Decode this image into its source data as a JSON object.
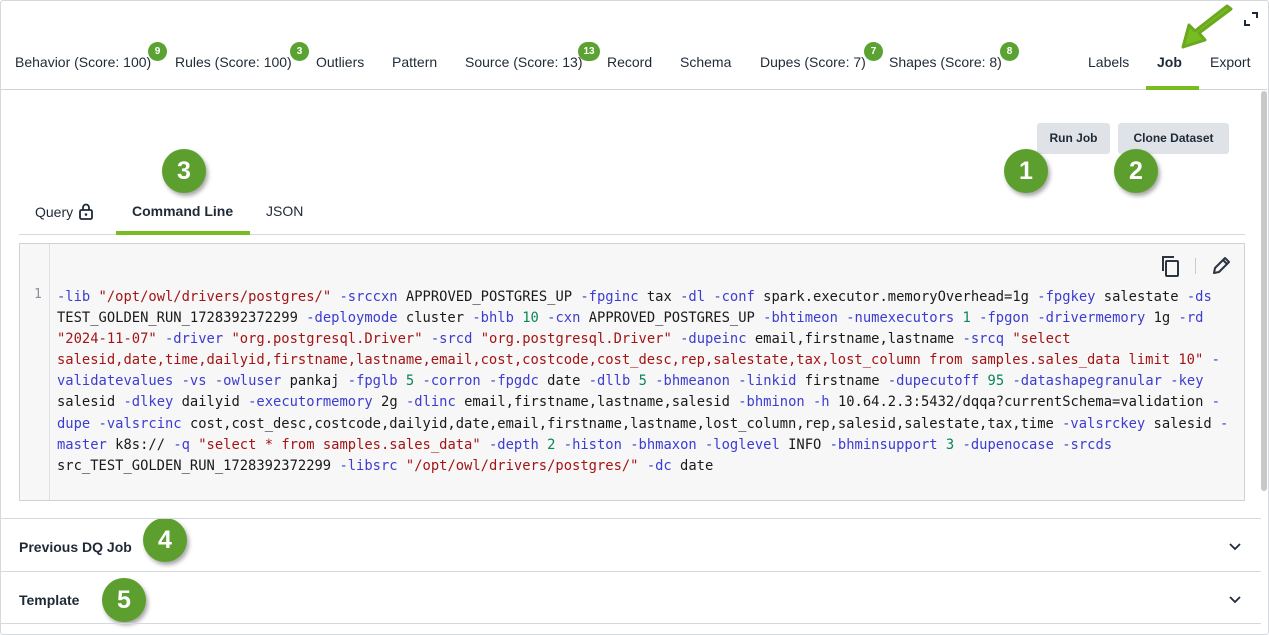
{
  "tabs": [
    {
      "label": "Behavior (Score: 100)",
      "badge": "9"
    },
    {
      "label": "Rules (Score: 100)",
      "badge": "3"
    },
    {
      "label": "Outliers"
    },
    {
      "label": "Pattern"
    },
    {
      "label": "Source (Score: 13)",
      "badge": "13"
    },
    {
      "label": "Record"
    },
    {
      "label": "Schema"
    },
    {
      "label": "Dupes (Score: 7)",
      "badge": "7"
    },
    {
      "label": "Shapes (Score: 8)",
      "badge": "8"
    },
    {
      "label": "Labels"
    },
    {
      "label": "Job",
      "active": true
    },
    {
      "label": "Export"
    }
  ],
  "buttons": {
    "run_job": "Run Job",
    "clone_dataset": "Clone Dataset"
  },
  "subtabs": [
    {
      "label": "Query",
      "icon": "lock-icon"
    },
    {
      "label": "Command Line",
      "active": true
    },
    {
      "label": "JSON"
    }
  ],
  "annotations": [
    "1",
    "2",
    "3",
    "4",
    "5"
  ],
  "code": {
    "line_number": "1",
    "command": "-lib \"/opt/owl/drivers/postgres/\" -srccxn APPROVED_POSTGRES_UP -fpginc tax -dl -conf spark.executor.memoryOverhead=1g -fpgkey salestate -ds TEST_GOLDEN_RUN_1728392372299 -deploymode cluster -bhlb 10 -cxn APPROVED_POSTGRES_UP -bhtimeon -numexecutors 1 -fpgon -drivermemory 1g -rd \"2024-11-07\" -driver \"org.postgresql.Driver\" -srcd \"org.postgresql.Driver\" -dupeinc email,firstname,lastname -srcq \"select salesid,date,time,dailyid,firstname,lastname,email,cost,costcode,cost_desc,rep,salestate,tax,lost_column from samples.sales_data limit 10\" -validatevalues -vs -owluser pankaj -fpglb 5 -corron -fpgdc date -dllb 5 -bhmeanon -linkid firstname -dupecutoff 95 -datashapegranular -key salesid -dlkey dailyid -executormemory 2g -dlinc email,firstname,lastname,salesid -bhminon -h 10.64.2.3:5432/dqqa?currentSchema=validation -dupe -valsrcinc cost,cost_desc,costcode,dailyid,date,email,firstname,lastname,lost_column,rep,salesid,salestate,tax,time -valsrckey salesid -master k8s:// -q \"select * from samples.sales_data\" -depth 2 -histon -bhmaxon -loglevel INFO -bhminsupport 3 -dupenocase -srcds src_TEST_GOLDEN_RUN_1728392372299 -libsrc \"/opt/owl/drivers/postgres/\" -dc date"
  },
  "accordions": [
    {
      "label": "Previous DQ Job"
    },
    {
      "label": "Template"
    }
  ],
  "colors": {
    "accent": "#77bd22",
    "badge": "#5aa332",
    "flag": "#3c3cd0",
    "string": "#a31515",
    "number": "#098658"
  }
}
